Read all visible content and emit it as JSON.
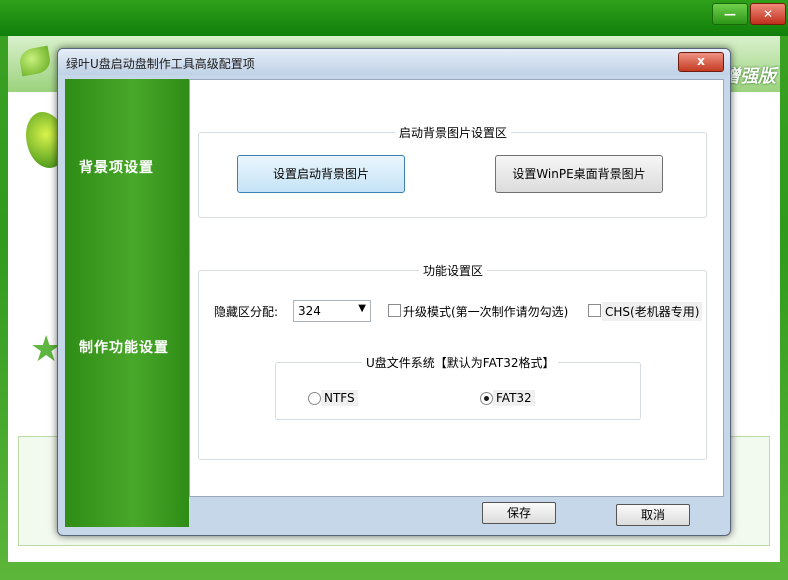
{
  "background_app": {
    "brand_suffix": "增强版",
    "minimize_glyph": "—",
    "close_glyph": "✕"
  },
  "dialog": {
    "title": "绿叶U盘启动盘制作工具高级配置项",
    "close_glyph": "x"
  },
  "sidebar": {
    "items": [
      {
        "label": "背景项设置"
      },
      {
        "label": "制作功能设置"
      }
    ]
  },
  "background_group": {
    "title": "启动背景图片设置区",
    "btn_boot_bg": "设置启动背景图片",
    "btn_winpe_bg": "设置WinPE桌面背景图片"
  },
  "function_group": {
    "title": "功能设置区",
    "hidden_partition_label": "隐藏区分配:",
    "hidden_partition_value": "324",
    "upgrade_mode_label": "升级模式(第一次制作请勿勾选)",
    "upgrade_mode_checked": false,
    "chs_label": "CHS(老机器专用)",
    "chs_checked": false,
    "fs_group": {
      "title": "U盘文件系统【默认为FAT32格式】",
      "options": [
        {
          "label": "NTFS",
          "selected": false
        },
        {
          "label": "FAT32",
          "selected": true
        }
      ]
    }
  },
  "footer": {
    "save_label": "保存",
    "cancel_label": "取消"
  },
  "colors": {
    "sidebar_green": "#3c9c20",
    "accent_button": "#c5e3f6",
    "close_red": "#c43b23"
  }
}
